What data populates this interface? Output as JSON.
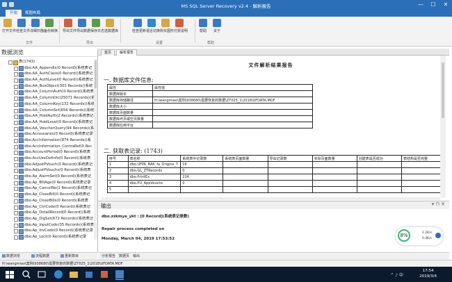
{
  "window": {
    "title": "MS SQL Server Recovery v2.4 - 解析报告",
    "controls": [
      "—",
      "☐",
      "✕"
    ]
  },
  "ribbon": {
    "tabs": [
      "开始",
      "视图布局"
    ],
    "buttons": [
      {
        "label": "打开文件",
        "color": "#d9a640"
      },
      {
        "label": "检查文件",
        "color": "#3b79c3"
      },
      {
        "label": "详细扫描",
        "color": "#3b79c3"
      },
      {
        "label": "备份转换",
        "color": "#5b9b4a"
      },
      {
        "label": "导出文件",
        "color": "#d25f3b"
      },
      {
        "label": "导出数据",
        "color": "#3b79c3"
      },
      {
        "label": "保存日志",
        "color": "#5b9b4a"
      },
      {
        "label": "选数据库",
        "color": "#d9a640"
      },
      {
        "label": "检查更新",
        "color": "#3b79c3"
      },
      {
        "label": "语言切换",
        "color": "#2b8ad0"
      },
      {
        "label": "购买图形",
        "color": "#d9a640"
      },
      {
        "label": "付费说明",
        "color": "#d25f3b"
      },
      {
        "label": "帮助",
        "color": "#3b79c3"
      },
      {
        "label": "关于",
        "color": "#3b79c3"
      }
    ],
    "groups": [
      "文件",
      "导出",
      "设置",
      "帮助"
    ]
  },
  "left_panel": {
    "header": "数据浏览",
    "root": "表(1743)",
    "items": [
      "dbo.AA_Appendix(0 Record)(系统表记",
      "dbo.AA_AuthClass(0 Record)(系统表记",
      "dbo.AA_AuthLevel(0 Record)(系统表记",
      "dbo.AA_BusObject(303 Records)(系统",
      "dbo.AA_ColumnAuth(0 Record)(系统表",
      "dbo.AA_ColumnDic(25071 Records)(系",
      "dbo.AA_ColumnKey(132 Records)(系统",
      "dbo.AA_ColumnSet(656 Records)(系统",
      "dbo.AA_HoldAuth(2 Records)(系统表记",
      "dbo.AA_HoldLevel(0 Record)(系统表记",
      "dbo.AA_VoucherQuery(94 Records)(系",
      "dbo.Accessaries(0 Record)(系统表记录",
      "dbo.AccInformation(874 Records)(系",
      "dbo.AccInformation_ContraRef(0 Rec",
      "dbo.AccountPeriod(0 Record)(系统表",
      "dbo.AccUseDefinfo(0 Record)(系统表",
      "dbo.AdjustPVouch(0 Record)(系统表记",
      "dbo.AdjustPVouchs(0 Record)(系统表",
      "dbo.Ap_AlarmSet(0 Record)(系统表记",
      "dbo.Ap_BillAge(0 Record)(系统表记录",
      "dbo.Ap_CancelNo(1 Record)(系统表记",
      "dbo.Ap_CloseBill(0 Record)(系统表记",
      "dbo.Ap_CloseBills(0 Record)(系统表",
      "dbo.Ap_CtrlCode(0 Record)(系统表记",
      "dbo.Ap_DetailRecord(0 Record)(系统",
      "dbo.Ap_DigSet(672 Records)(系统表记",
      "dbo.Ap_InputCode(35 Records)(系统表",
      "dbo.Ap_InvCode(0 Record)(系统表记录",
      "dbo.Ap_Lock(0 Record)(系统表记录"
    ],
    "bottom_tabs": [
      "数据浏览",
      "流程数据",
      "重新数目"
    ]
  },
  "doc_tabs": [
    "首页",
    "解析报告"
  ],
  "report": {
    "title": "文件解析结果报告",
    "section1": "一. 数据库文件信息:",
    "info_header": [
      "属性",
      "属性值"
    ],
    "info_rows": [
      [
        "数据库版本",
        ""
      ],
      [
        "数据库存储路径",
        "H:\\wangmiao\\案例\\938680\\需要恢复的数据\\ZT025_1\\2018\\UFDATA.MDF"
      ],
      [
        "数据库大小",
        ""
      ],
      [
        "数据库页面数量",
        ""
      ],
      [
        "数据库坏页或空页数量",
        ""
      ],
      [
        "数据库应用平台",
        ""
      ]
    ],
    "section2": "二. 获取表记录: (1743)",
    "rec_header": [
      "序号",
      "表名称",
      "系统表中记录数",
      "系统表页面数量",
      "导出记录数",
      "实际页面数量",
      "创建表是否成功",
      "表结构是否完整"
    ],
    "rec_rows": [
      [
        "1",
        "dbo.UFPA_BAK_fa_Origins_7",
        "16",
        "",
        "",
        "",
        "",
        ""
      ],
      [
        "2",
        "dbo.GL_ZTRecords",
        "0",
        "",
        "",
        "",
        "",
        ""
      ],
      [
        "3",
        "dbo.PrintEx",
        "224",
        "",
        "",
        "",
        "",
        ""
      ],
      [
        "4",
        "dbo.PU_AppVouchs",
        "0",
        "",
        "",
        "",
        "",
        ""
      ],
      [
        "5",
        "",
        "",
        "",
        "",
        "",
        "",
        ""
      ]
    ]
  },
  "output": {
    "header": "输出",
    "pin": "▾ ⊓ ✕",
    "lines": [
      "dbo.zzkmye_ykt : [0 Record](系统表记录数)",
      "Repair process completed on",
      "Monday, March 04, 2019 17:53:52"
    ],
    "tabs": [
      "分析报告",
      "数据页",
      "输出"
    ]
  },
  "perf": {
    "percent": "8%",
    "up": "1.2K/s",
    "down": "0.4K/s"
  },
  "status": {
    "path": "H:\\wangmiao\\案例\\938680\\需要恢复的数据\\ZT025_1\\2018\\UFDATA.MDF"
  },
  "taskbar": {
    "time": "17:54",
    "date": "2019/3/4",
    "tray": "^ ♪ 中"
  }
}
